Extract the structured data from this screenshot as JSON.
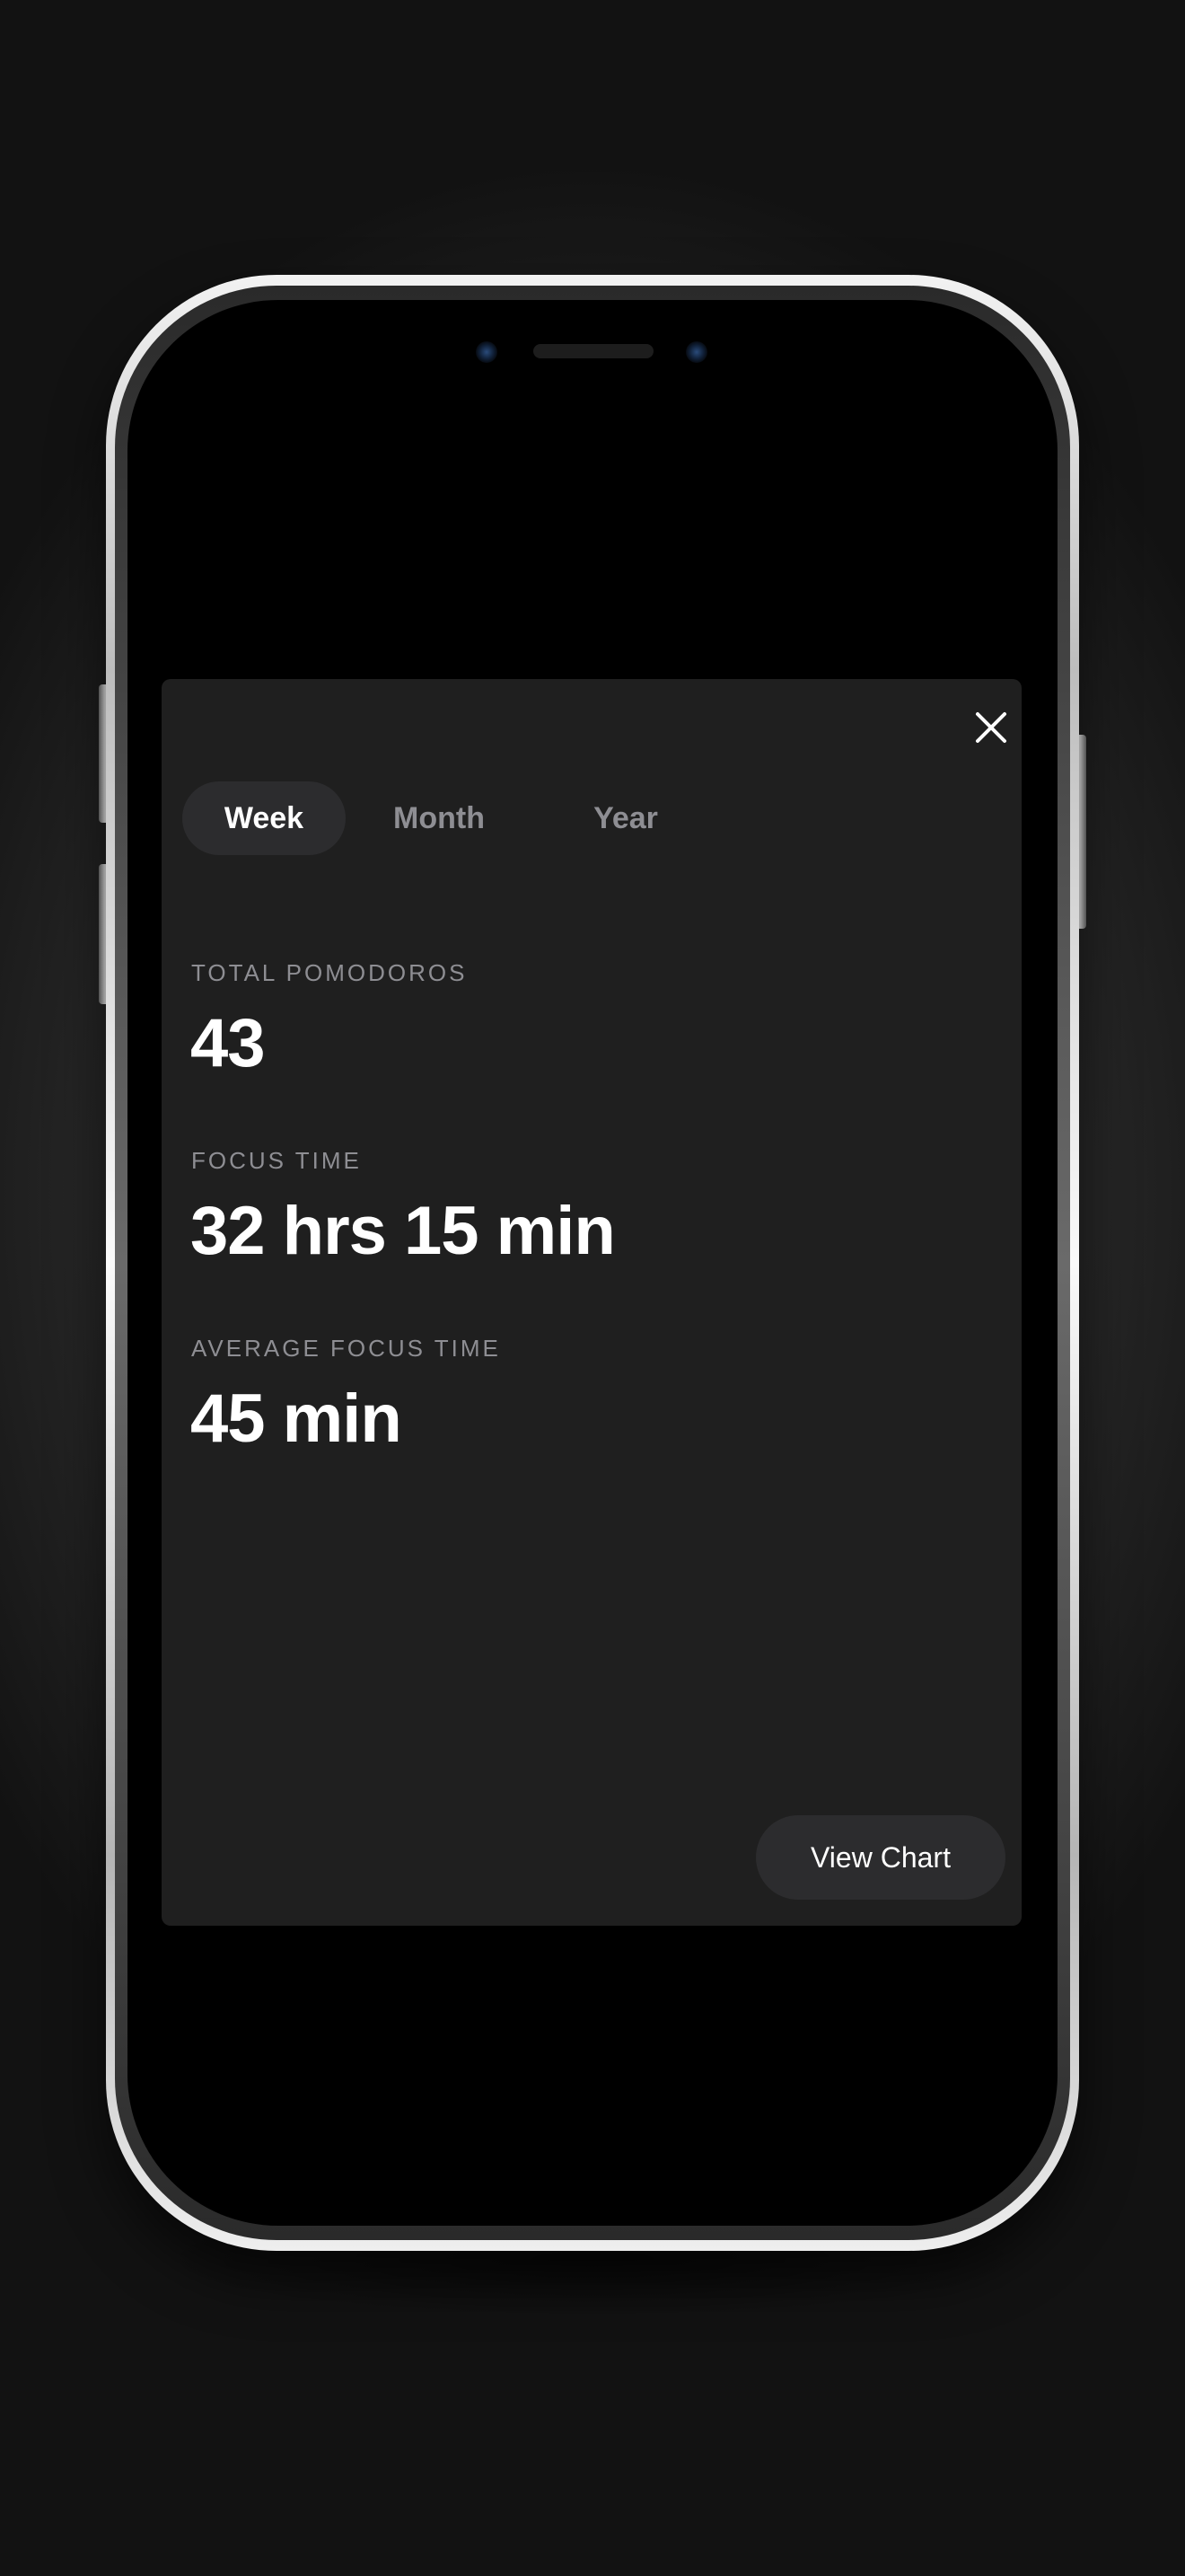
{
  "colors": {
    "sheet_background": "#1f1f1f",
    "segment_active_background": "#2c2c2e",
    "text_primary": "#ffffff",
    "text_secondary": "#8e8e93"
  },
  "header": {
    "close_icon": "close-icon"
  },
  "period_tabs": {
    "selected": "Week",
    "items": [
      {
        "label": "Week",
        "active": true
      },
      {
        "label": "Month",
        "active": false
      },
      {
        "label": "Year",
        "active": false
      }
    ]
  },
  "stats": [
    {
      "label": "TOTAL POMODOROS",
      "value": "43"
    },
    {
      "label": "FOCUS TIME",
      "value": "32 hrs 15 min"
    },
    {
      "label": "AVERAGE FOCUS TIME",
      "value": "45 min"
    }
  ],
  "actions": {
    "view_chart_label": "View Chart"
  }
}
